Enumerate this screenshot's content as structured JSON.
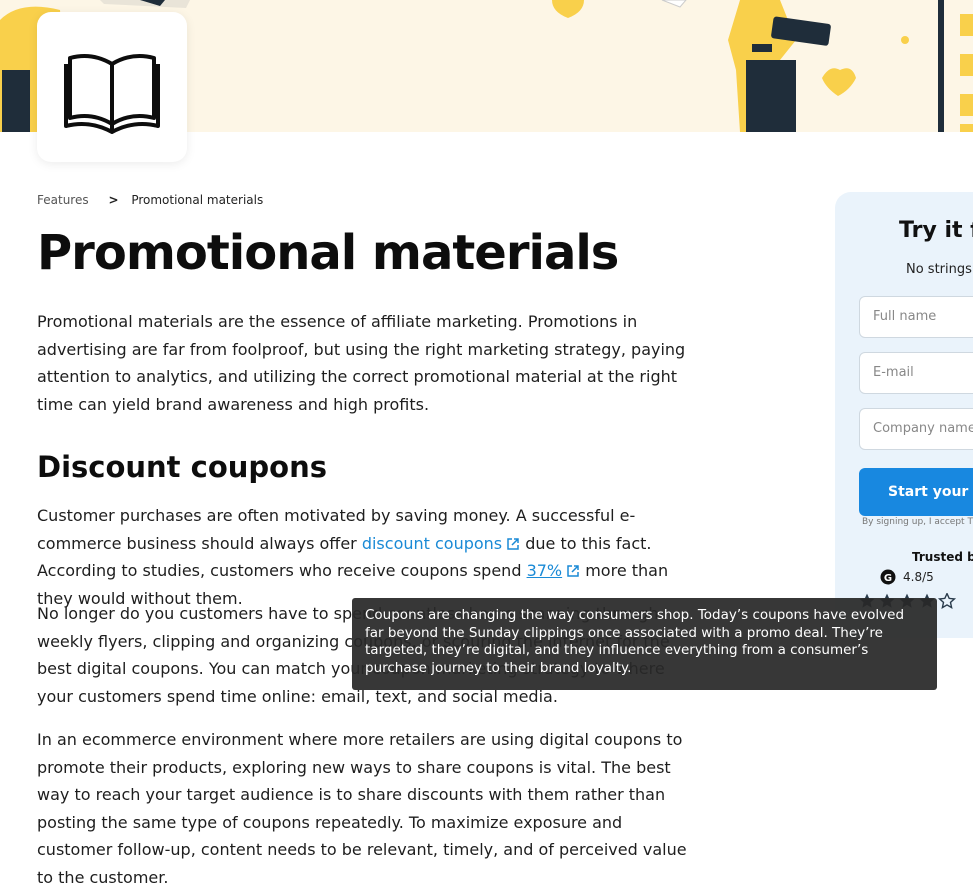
{
  "breadcrumb": {
    "parent": "Features",
    "separator": ">",
    "current": "Promotional materials"
  },
  "page_title": "Promotional materials",
  "intro": "Promotional materials are the essence of affiliate marketing. Promotions in advertising are far from foolproof, but using the right marketing strategy, paying attention to analytics, and utilizing the correct promotional material at the right time can yield brand awareness and high profits.",
  "section": {
    "heading": "Discount coupons",
    "p1": {
      "t1": "Customer purchases are often motivated by saving money. A successful e-commerce business should always offer ",
      "link1": "discount coupons",
      "t2": " due to this fact. According to studies, customers who receive coupons spend ",
      "link2": "37%",
      "t3": " more than they would without them."
    },
    "p2": "No longer do you customers have to spend countless hours scanning through weekly flyers, clipping and organizing coupons, or scouring the internet for the best digital coupons. You can match your coupon marketing strategy to where your customers spend time online: email, text, and social media.",
    "p3": "In an ecommerce environment where more retailers are using digital coupons to promote their products, exploring new ways to share coupons is vital. The best way to reach your target audience is to share discounts with them rather than posting the same type of coupons repeatedly. To maximize exposure and customer follow-up, content needs to be relevant, timely, and of perceived value to the customer."
  },
  "tooltip": "Coupons are changing the way consumers shop. Today’s coupons have evolved far beyond the Sunday clippings once associated with a promo deal. They’re targeted, they’re digital, and they influence everything from a consumer’s purchase journey to their brand loyalty.",
  "signup": {
    "title": "Try it fo",
    "subtitle": "No strings",
    "full_name_placeholder": "Full name",
    "email_placeholder": "E-mail",
    "company_placeholder": "Company name",
    "cta": "Start your fr",
    "legal": "By signing up, I accept T",
    "trusted": "Trusted by",
    "rating": "4.8/5",
    "stars": 4.5
  },
  "icons": {
    "hero_icon": "open-book-icon",
    "external": "external-link-icon",
    "g2": "g2-logo-icon",
    "star": "star-icon"
  },
  "colors": {
    "accent": "#1888e0",
    "link": "#1a8ad6",
    "hero_bg": "#fdf6e6",
    "hero_yellow": "#f9d04b",
    "panel_bg": "#eaf3fb",
    "tooltip_bg": "#282828"
  }
}
